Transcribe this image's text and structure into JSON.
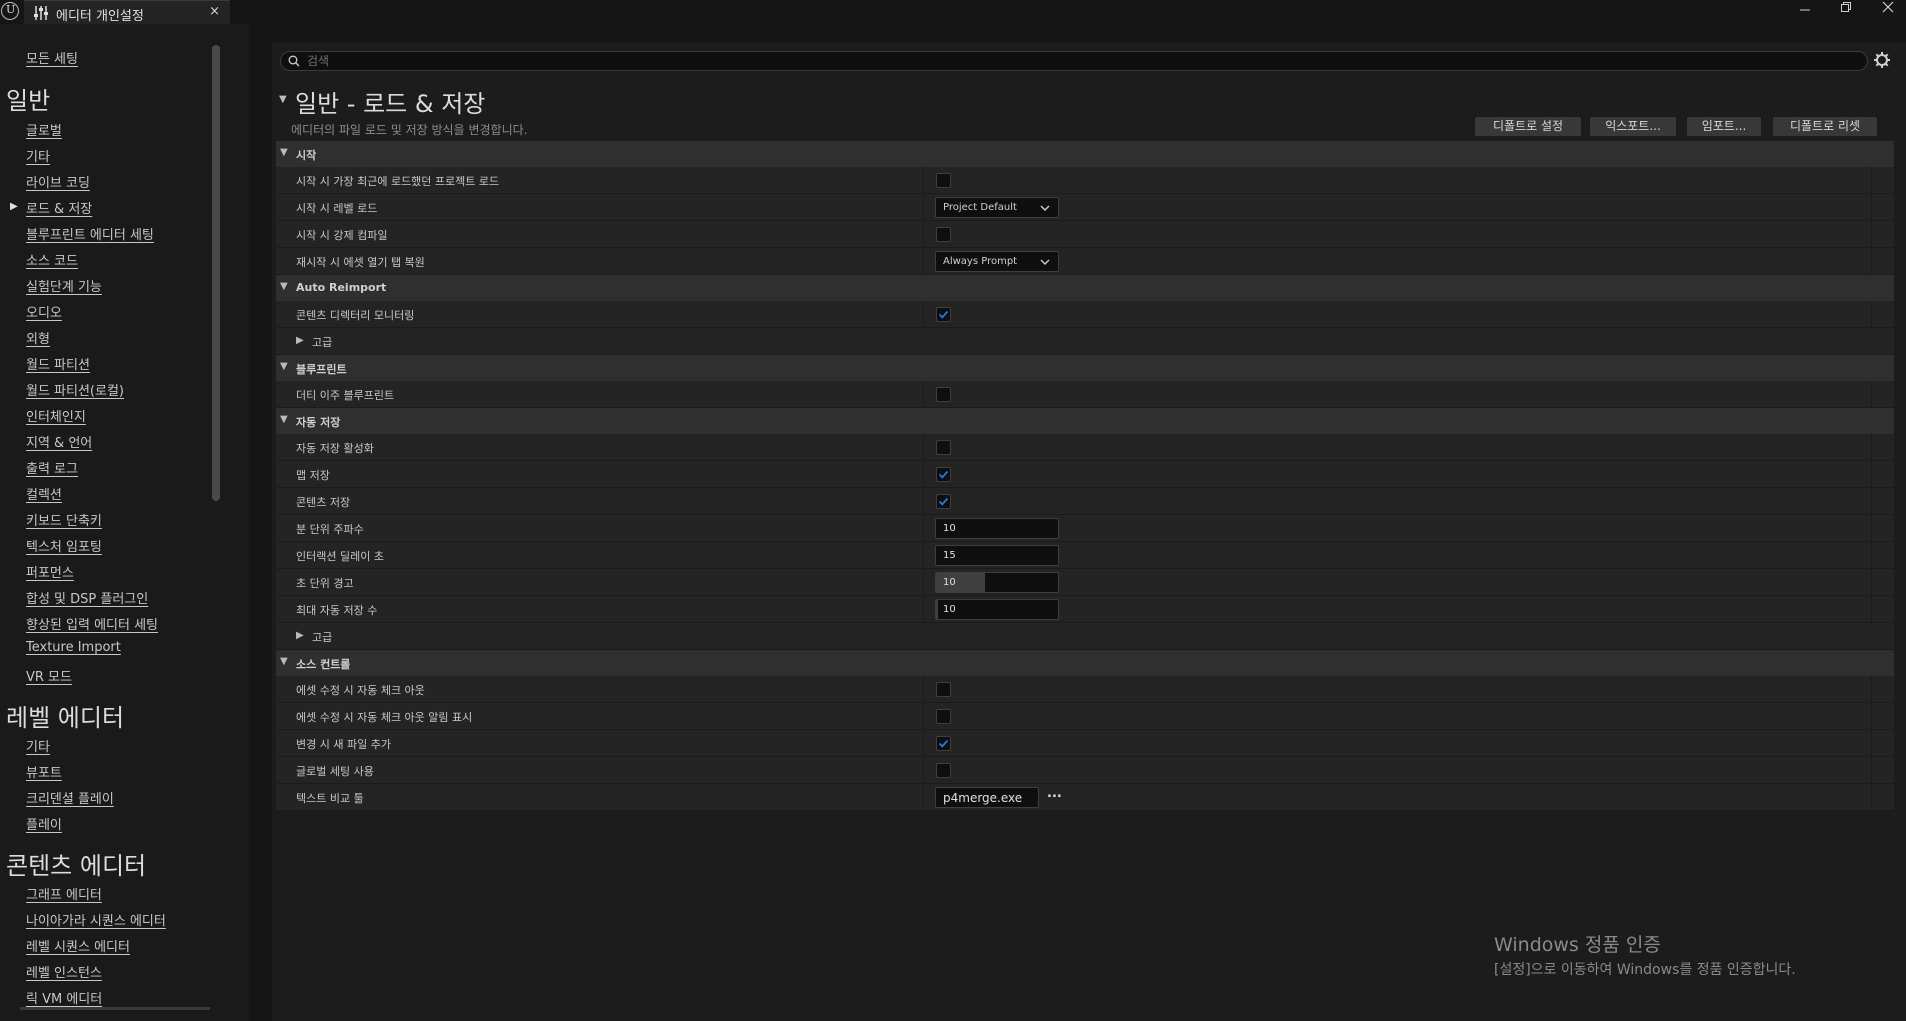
{
  "window": {
    "tab_title": "에디터 개인설정",
    "tab_close": "×"
  },
  "sidebar": {
    "top_link": "모든 세팅",
    "sections": [
      {
        "heading": "일반",
        "items": [
          "글로벌",
          "기타",
          "라이브 코딩",
          "로드 & 저장",
          "블루프린트 에디터 세팅",
          "소스 코드",
          "실험단계 기능",
          "오디오",
          "외형",
          "월드 파티션",
          "월드 파티션(로컬)",
          "인터체인지",
          "지역 & 언어",
          "출력 로그",
          "컬렉션",
          "키보드 단축키",
          "텍스처 임포팅",
          "퍼포먼스",
          "합성 및 DSP 플러그인",
          "향상된 입력 에디터 세팅",
          "Texture Import",
          "VR 모드"
        ]
      },
      {
        "heading": "레벨 에디터",
        "items": [
          "기타",
          "뷰포트",
          "크리덴셜 플레이",
          "플레이"
        ]
      },
      {
        "heading": "콘텐츠 에디터",
        "items": [
          "그래프 에디터",
          "나이아가라 시퀀스 에디터",
          "레벨 시퀀스 에디터",
          "레벨 인스턴스",
          "릭 VM 에디터"
        ]
      }
    ],
    "selected_item": "로드 & 저장"
  },
  "search": {
    "placeholder": "검색"
  },
  "page": {
    "title": "일반 - 로드 & 저장",
    "description": "에디터의 파일 로드 및 저장 방식을 변경합니다."
  },
  "buttons": {
    "set_default": "디폴트로 설정",
    "export": "익스포트...",
    "import": "임포트...",
    "reset_default": "디폴트로 리셋"
  },
  "categories": {
    "startup": "시작",
    "auto_reimport": "Auto Reimport",
    "blueprint": "블루프린트",
    "autosave": "자동 저장",
    "source_control": "소스 컨트롤"
  },
  "rows": {
    "load_last_project": {
      "label": "시작 시 가장 최근에 로드했던 프로젝트 로드",
      "checked": false
    },
    "load_level_startup": {
      "label": "시작 시 레벨 로드",
      "value": "Project Default"
    },
    "force_compile": {
      "label": "시작 시 강제 컴파일",
      "checked": false
    },
    "restore_asset_tabs": {
      "label": "재시작 시 에셋 열기 탭 복원",
      "value": "Always Prompt"
    },
    "monitor_content_dirs": {
      "label": "콘텐츠 디렉터리 모니터링",
      "checked": true
    },
    "reimport_advanced": {
      "label": "고급"
    },
    "dirty_blueprints": {
      "label": "더티 이주 블루프린트",
      "checked": false
    },
    "enable_autosave": {
      "label": "자동 저장 활성화",
      "checked": false
    },
    "save_maps": {
      "label": "맵 저장",
      "checked": true
    },
    "save_content": {
      "label": "콘텐츠 저장",
      "checked": true
    },
    "frequency_minutes": {
      "label": "분 단위 주파수",
      "value": "10"
    },
    "interaction_delay": {
      "label": "인터랙션 딜레이 초",
      "value": "15"
    },
    "warning_seconds": {
      "label": "초 단위 경고",
      "value": "10",
      "fill_fraction": 0.4
    },
    "max_autosaves": {
      "label": "최대 자동 저장 수",
      "value": "10",
      "fill_fraction": 0.02
    },
    "autosave_advanced": {
      "label": "고급"
    },
    "auto_checkout": {
      "label": "에셋 수정 시 자동 체크 아웃",
      "checked": false
    },
    "auto_checkout_notify": {
      "label": "에셋 수정 시 자동 체크 아웃 알림 표시",
      "checked": false
    },
    "add_new_files": {
      "label": "변경 시 새 파일 추가",
      "checked": true
    },
    "use_global_settings": {
      "label": "글로벌 세팅 사용",
      "checked": false
    },
    "text_diff_tool": {
      "label": "텍스트 비교 툴",
      "value": "p4merge.exe",
      "browse": "..."
    }
  },
  "watermark": {
    "title": "Windows 정품 인증",
    "subtitle": "[설정]으로 이동하여 Windows를 정품 인증합니다."
  },
  "colors": {
    "checkbox_accent": "#1a7ee6",
    "background": "#1c1c1c",
    "row_background": "#242424",
    "category_background": "#2f2f2f"
  }
}
